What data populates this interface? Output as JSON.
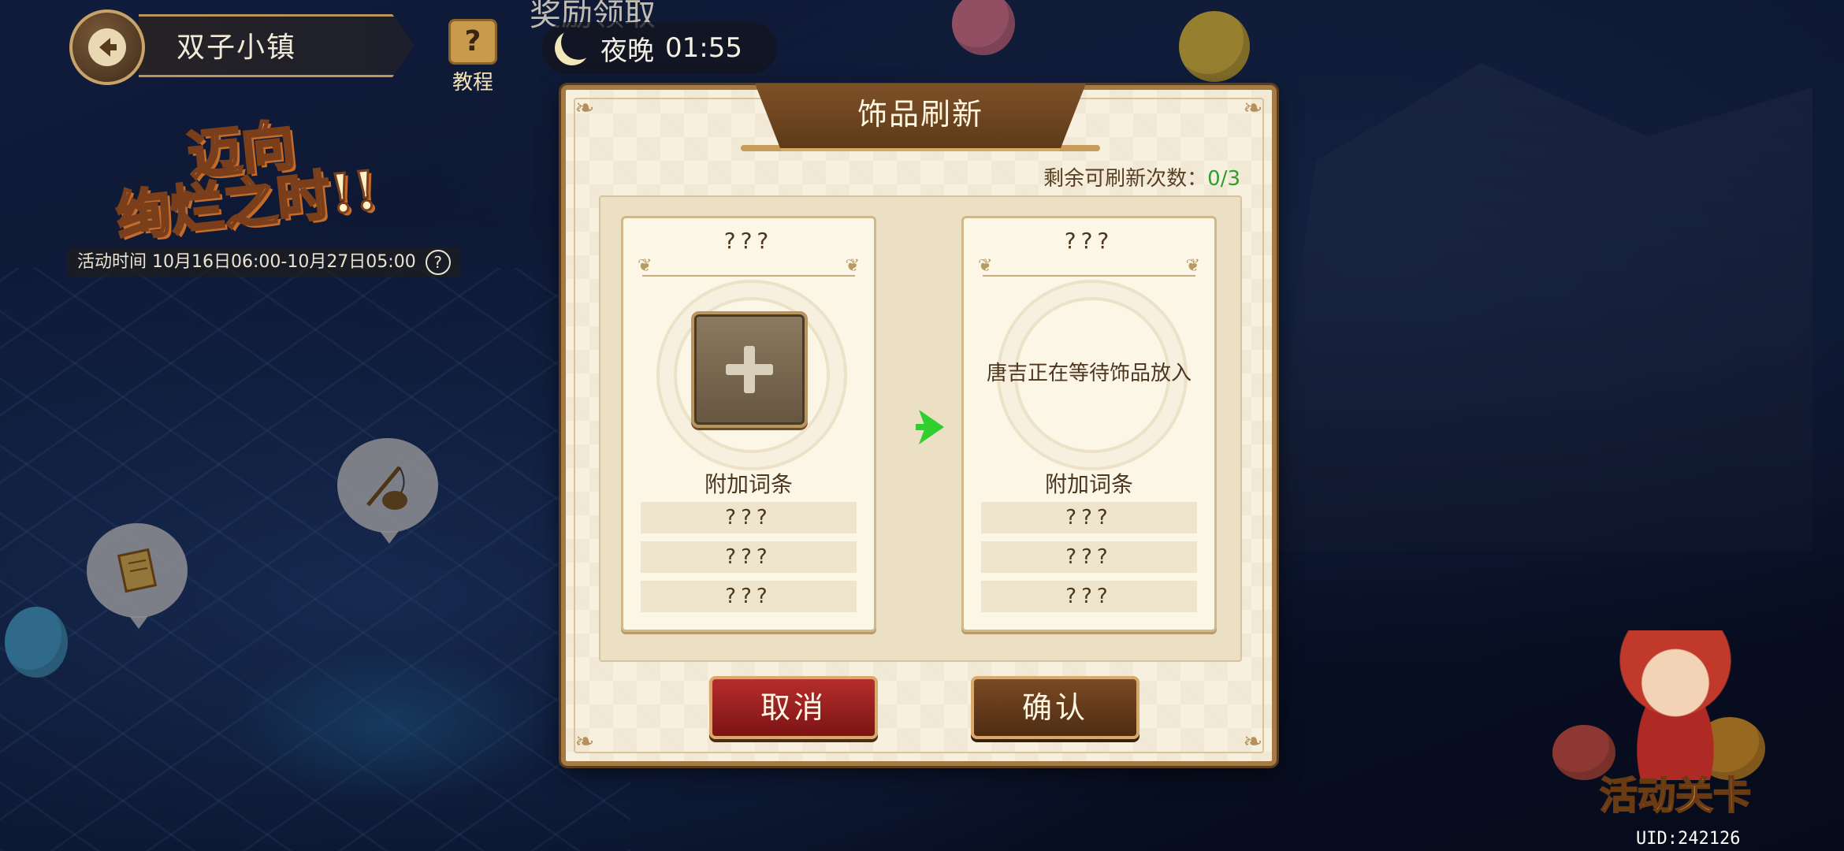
{
  "hud": {
    "location_title": "双子小镇",
    "tutorial_label": "教程",
    "tutorial_icon_glyph": "?",
    "reward_label": "奖励领取",
    "time_of_day": "夜晚",
    "clock": "01:55"
  },
  "event": {
    "banner_title": "迈向\n绚烂之时!!",
    "time_label": "活动时间  10月16日06:00-10月27日05:00",
    "help_glyph": "?"
  },
  "bottom_right": {
    "stage_label": "活动关卡",
    "uid": "UID:242126"
  },
  "dialog": {
    "title": "饰品刷新",
    "remaining_label": "剩余可刷新次数：",
    "remaining_count": "0/3",
    "left_card": {
      "name": "???",
      "affix_title": "附加词条",
      "affixes": [
        "???",
        "???",
        "???"
      ]
    },
    "right_card": {
      "name": "???",
      "waiting_text": "唐吉正在等待饰品放入",
      "affix_title": "附加词条",
      "affixes": [
        "???",
        "???",
        "???"
      ]
    },
    "cancel_label": "取消",
    "confirm_label": "确认"
  },
  "colors": {
    "accent_green": "#2f9e2f",
    "cancel_red": "#b52d2d",
    "confirm_brown": "#7a4a24",
    "panel_cream": "#f7f0df"
  },
  "icons": {
    "back": "back-arrow-icon",
    "moon": "moon-icon",
    "add": "plus-icon",
    "arrow": "right-arrow-icon",
    "scroll": "scroll-icon",
    "fishing": "fishing-rod-icon"
  }
}
